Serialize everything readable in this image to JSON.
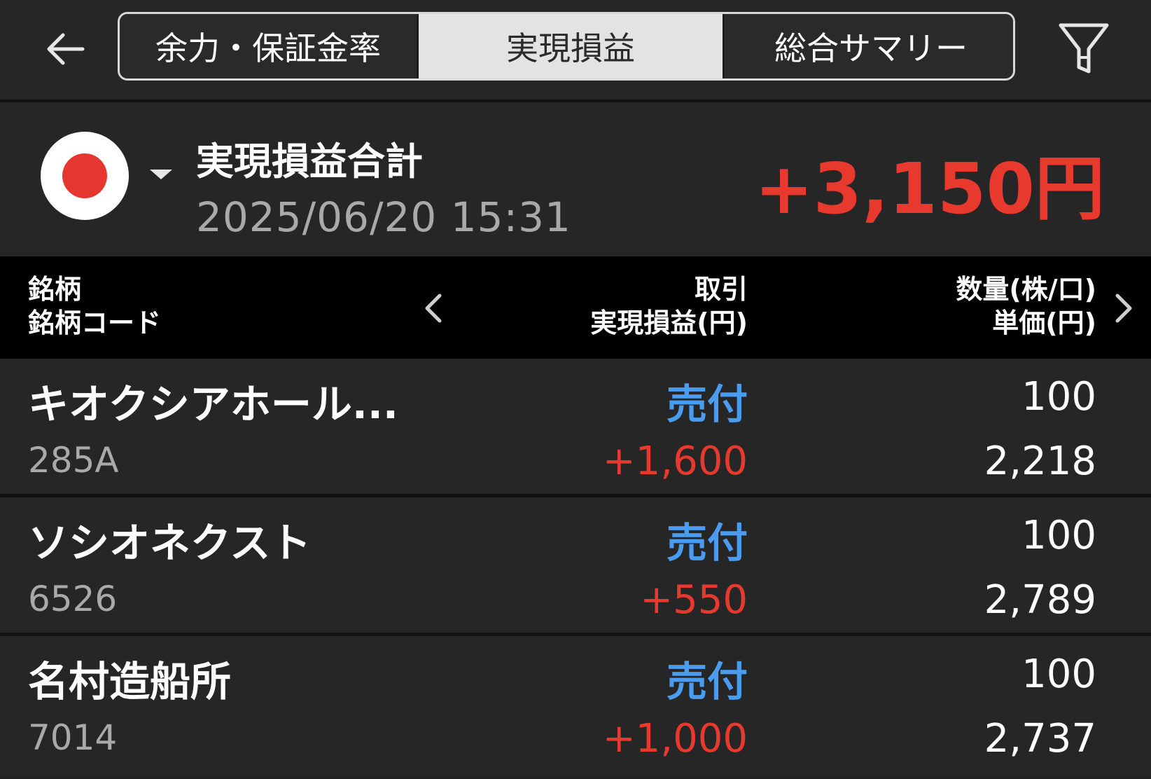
{
  "header": {
    "back_icon": "arrow-left-icon",
    "tabs": [
      {
        "label": "余力・保証金率",
        "active": false
      },
      {
        "label": "実現損益",
        "active": true
      },
      {
        "label": "総合サマリー",
        "active": false
      }
    ],
    "filter_icon": "filter-funnel-icon"
  },
  "summary": {
    "market_icon": "japan-flag-icon",
    "label": "実現損益合計",
    "datetime": "2025/06/20  15:31",
    "total": "+3,150円",
    "total_color": "#e8392f"
  },
  "table": {
    "headers": {
      "col1_line1": "銘柄",
      "col1_line2": "銘柄コード",
      "col2_line1": "取引",
      "col2_line2": "実現損益(円)",
      "col3_line1": "数量(株/口)",
      "col3_line2": "単価(円)"
    },
    "rows": [
      {
        "name": "キオクシアホール...",
        "code": "285A",
        "trade": "売付",
        "pl": "+1,600",
        "qty": "100",
        "price": "2,218"
      },
      {
        "name": "ソシオネクスト",
        "code": "6526",
        "trade": "売付",
        "pl": "+550",
        "qty": "100",
        "price": "2,789"
      },
      {
        "name": "名村造船所",
        "code": "7014",
        "trade": "売付",
        "pl": "+1,000",
        "qty": "100",
        "price": "2,737"
      }
    ]
  },
  "colors": {
    "background": "#222222",
    "profit": "#e8392f",
    "sell": "#4a9cf0",
    "muted": "#a9a9a9"
  }
}
